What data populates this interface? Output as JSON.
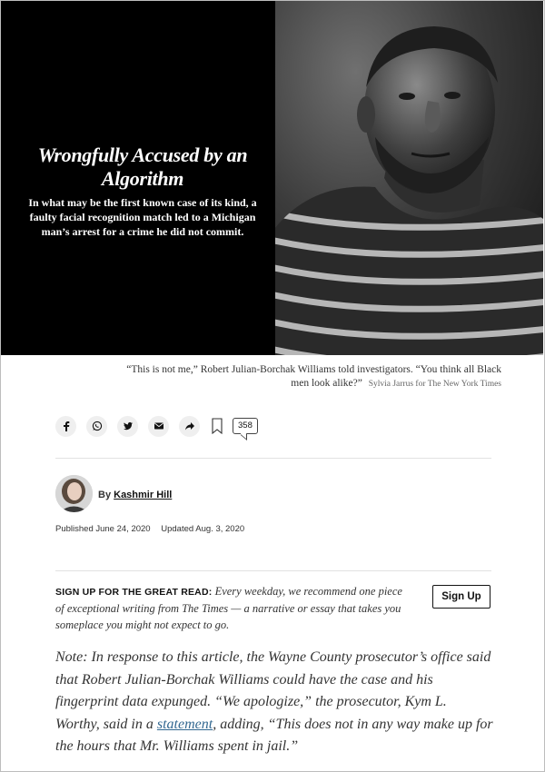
{
  "hero": {
    "title": "Wrongfully Accused by an Algorithm",
    "subtitle": "In what may be the first known case of its kind, a faulty facial recognition match led to a Michigan man’s arrest for a crime he did not commit."
  },
  "caption": {
    "text": "“This is not me,” Robert Julian-Borchak Williams told investigators. “You think all Black men look alike?”",
    "credit": "Sylvia Jarrus for The New York Times"
  },
  "share": {
    "icons": [
      "facebook-icon",
      "whatsapp-icon",
      "twitter-icon",
      "email-icon",
      "share-icon",
      "bookmark-icon"
    ],
    "comment_count": "358"
  },
  "byline": {
    "prefix": "By",
    "author": "Kashmir Hill"
  },
  "dates": {
    "published": "Published June 24, 2020",
    "updated": "Updated Aug. 3, 2020"
  },
  "newsletter": {
    "label": "SIGN UP FOR THE GREAT READ:",
    "text": "Every weekday, we recommend one piece of exceptional writing from The Times — a narrative or essay that takes you someplace you might not expect to go.",
    "button": "Sign Up"
  },
  "note": {
    "before": "Note: In response to this article, the Wayne County prosecutor’s office said that Robert Julian-Borchak Williams could have the case and his fingerprint data expunged. “We apologize,” the prosecutor, Kym L. Worthy, said in a",
    "link": "statement",
    "after": ", adding, “This does not in any way make up for the hours that Mr. Williams spent in jail.”"
  }
}
